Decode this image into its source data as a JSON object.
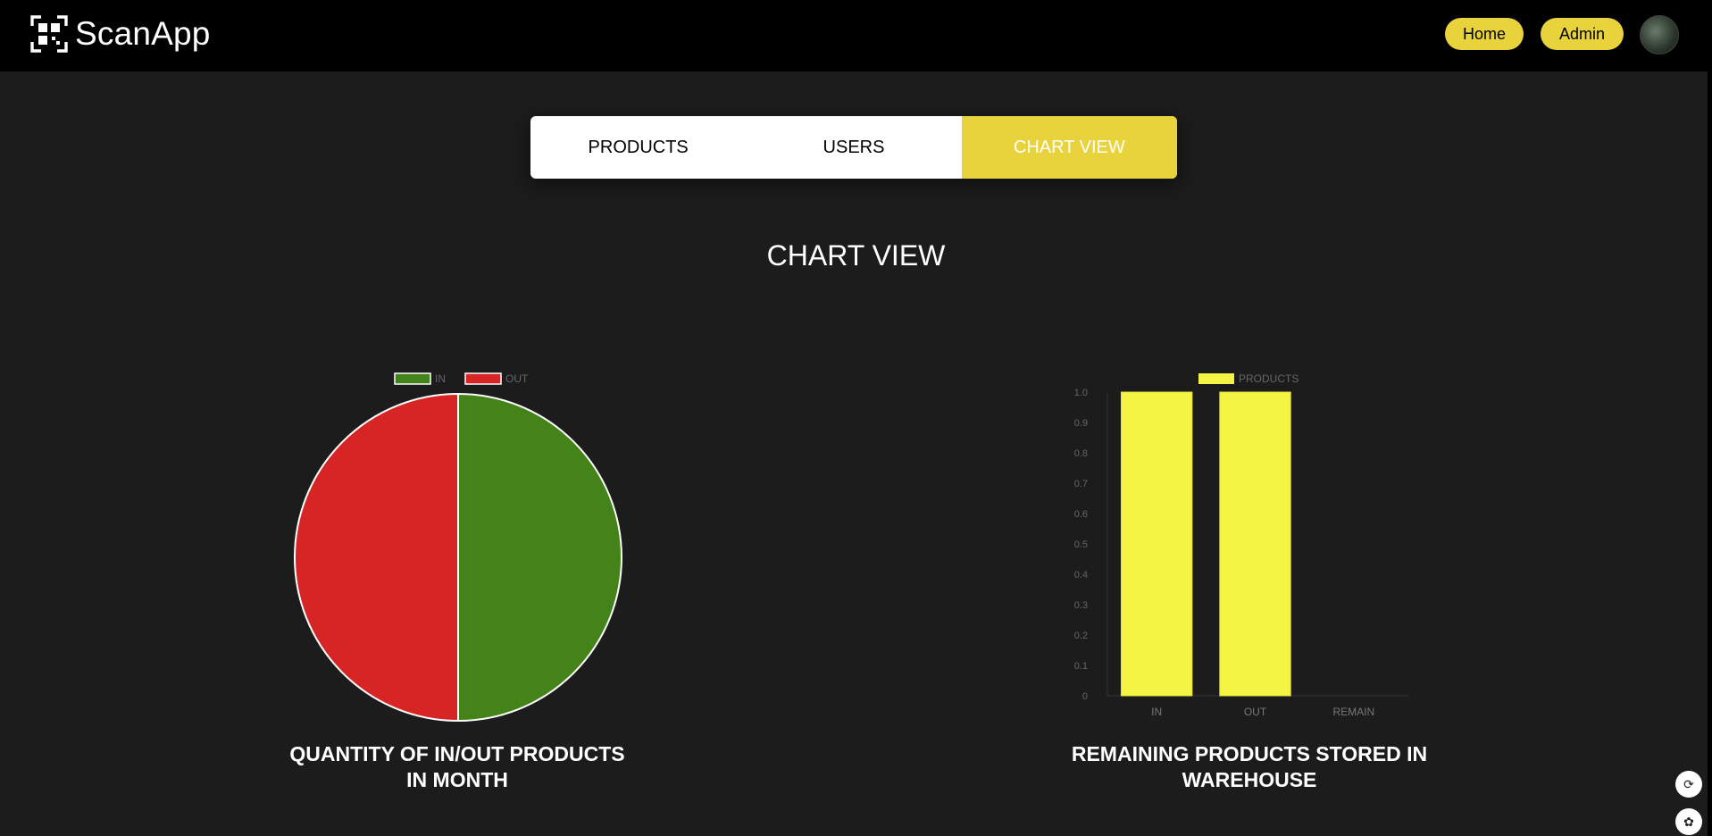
{
  "app": {
    "name": "ScanApp"
  },
  "nav": {
    "home": "Home",
    "admin": "Admin"
  },
  "tabs": [
    {
      "label": "PRODUCTS",
      "active": false
    },
    {
      "label": "USERS",
      "active": false
    },
    {
      "label": "CHART VIEW",
      "active": true
    }
  ],
  "page": {
    "title": "CHART VIEW"
  },
  "colors": {
    "accent": "#e8d33c",
    "in": "#44821a",
    "out": "#d72525",
    "bar": "#f3f444"
  },
  "chart_data": [
    {
      "type": "pie",
      "legend": [
        "IN",
        "OUT"
      ],
      "categories": [
        "IN",
        "OUT"
      ],
      "values": [
        1,
        1
      ],
      "colors": [
        "#44821a",
        "#d72525"
      ],
      "legend_position": "top",
      "caption": "QUANTITY OF IN/OUT PRODUCTS IN MONTH"
    },
    {
      "type": "bar",
      "categories": [
        "IN",
        "OUT",
        "REMAIN"
      ],
      "series": [
        {
          "name": "PRODUCTS",
          "values": [
            1,
            1,
            0
          ]
        }
      ],
      "ylim": [
        0,
        1
      ],
      "yticks": [
        "0",
        "0.1",
        "0.2",
        "0.3",
        "0.4",
        "0.5",
        "0.6",
        "0.7",
        "0.8",
        "0.9",
        "1.0"
      ],
      "legend_position": "top",
      "caption": "REMAINING PRODUCTS STORED IN WAREHOUSE"
    }
  ]
}
